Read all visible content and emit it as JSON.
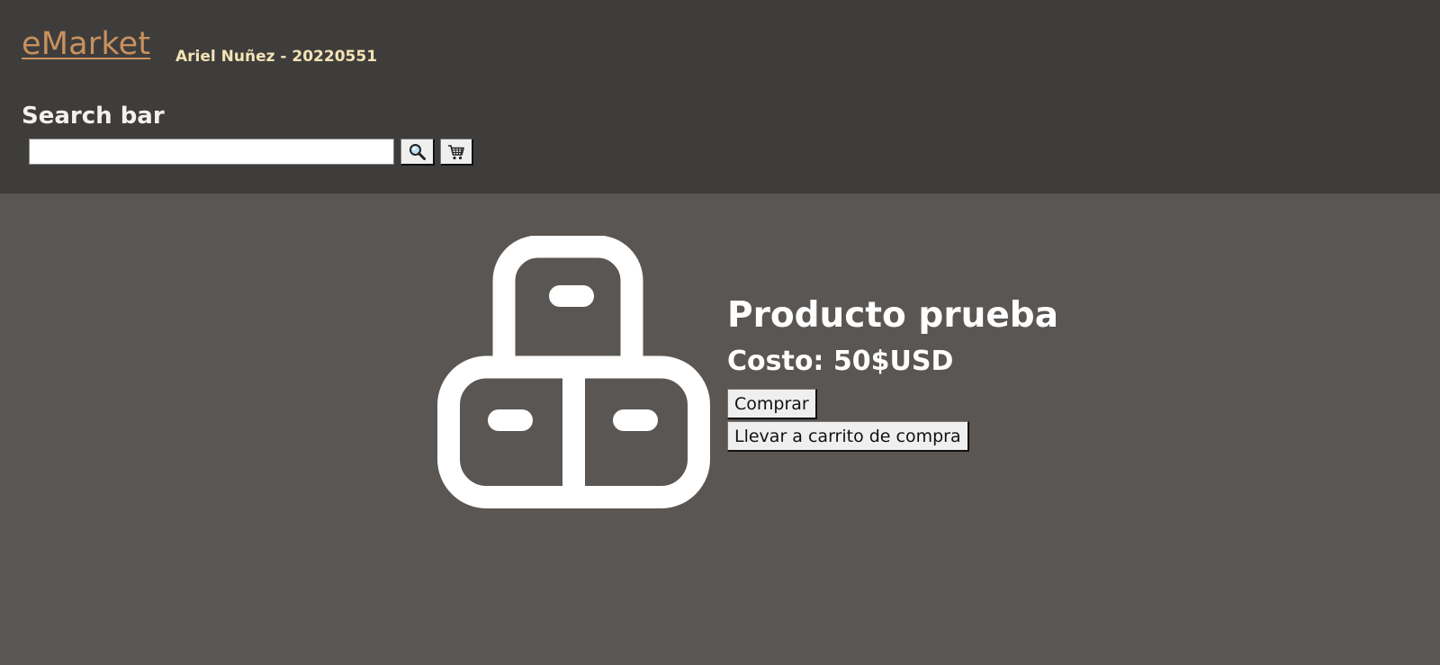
{
  "header": {
    "brand": "eMarket",
    "author": "Ariel Nuñez - 20220551",
    "search_title": "Search bar",
    "search_value": "",
    "search_icon": "magnifier-icon",
    "cart_icon": "shopping-cart-icon"
  },
  "product": {
    "image_icon": "boxes-icon",
    "name": "Producto prueba",
    "price": "Costo: 50$USD",
    "buy_label": "Comprar",
    "add_to_cart_label": "Llevar a carrito de compra"
  },
  "colors": {
    "header_bg": "#3f3d3b",
    "page_bg": "#5a5653",
    "brand": "#c8915f",
    "author": "#f3e3b6"
  }
}
